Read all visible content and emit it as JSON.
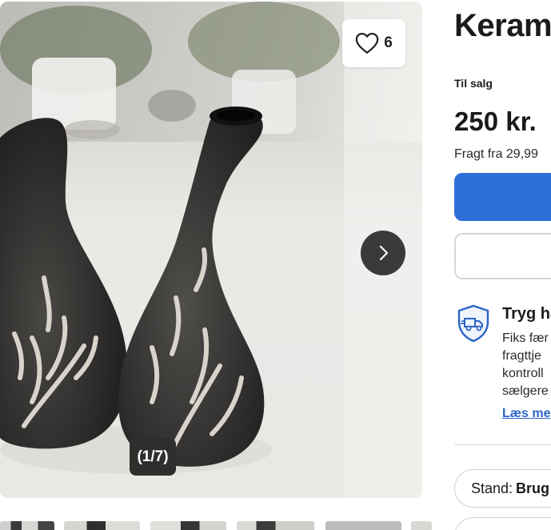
{
  "gallery": {
    "favorite_count": "6",
    "image_counter": "(1/7)",
    "thumbnails": [
      "",
      "",
      "",
      "",
      "",
      ""
    ]
  },
  "listing": {
    "title": "Keram",
    "sale_label": "Til salg",
    "price": "250 kr.",
    "shipping": "Fragt fra 29,99"
  },
  "trust": {
    "title": "Tryg ha",
    "lines": [
      "Fiks fær",
      "fragttje",
      "kontroll",
      "sælgere"
    ],
    "read_more": "Læs me"
  },
  "attributes": {
    "condition_label": "Stand:",
    "condition_value": "Brug"
  },
  "colors": {
    "accent": "#2f6fd9",
    "link": "#2c64c6",
    "overlay": "#3b3a38"
  }
}
